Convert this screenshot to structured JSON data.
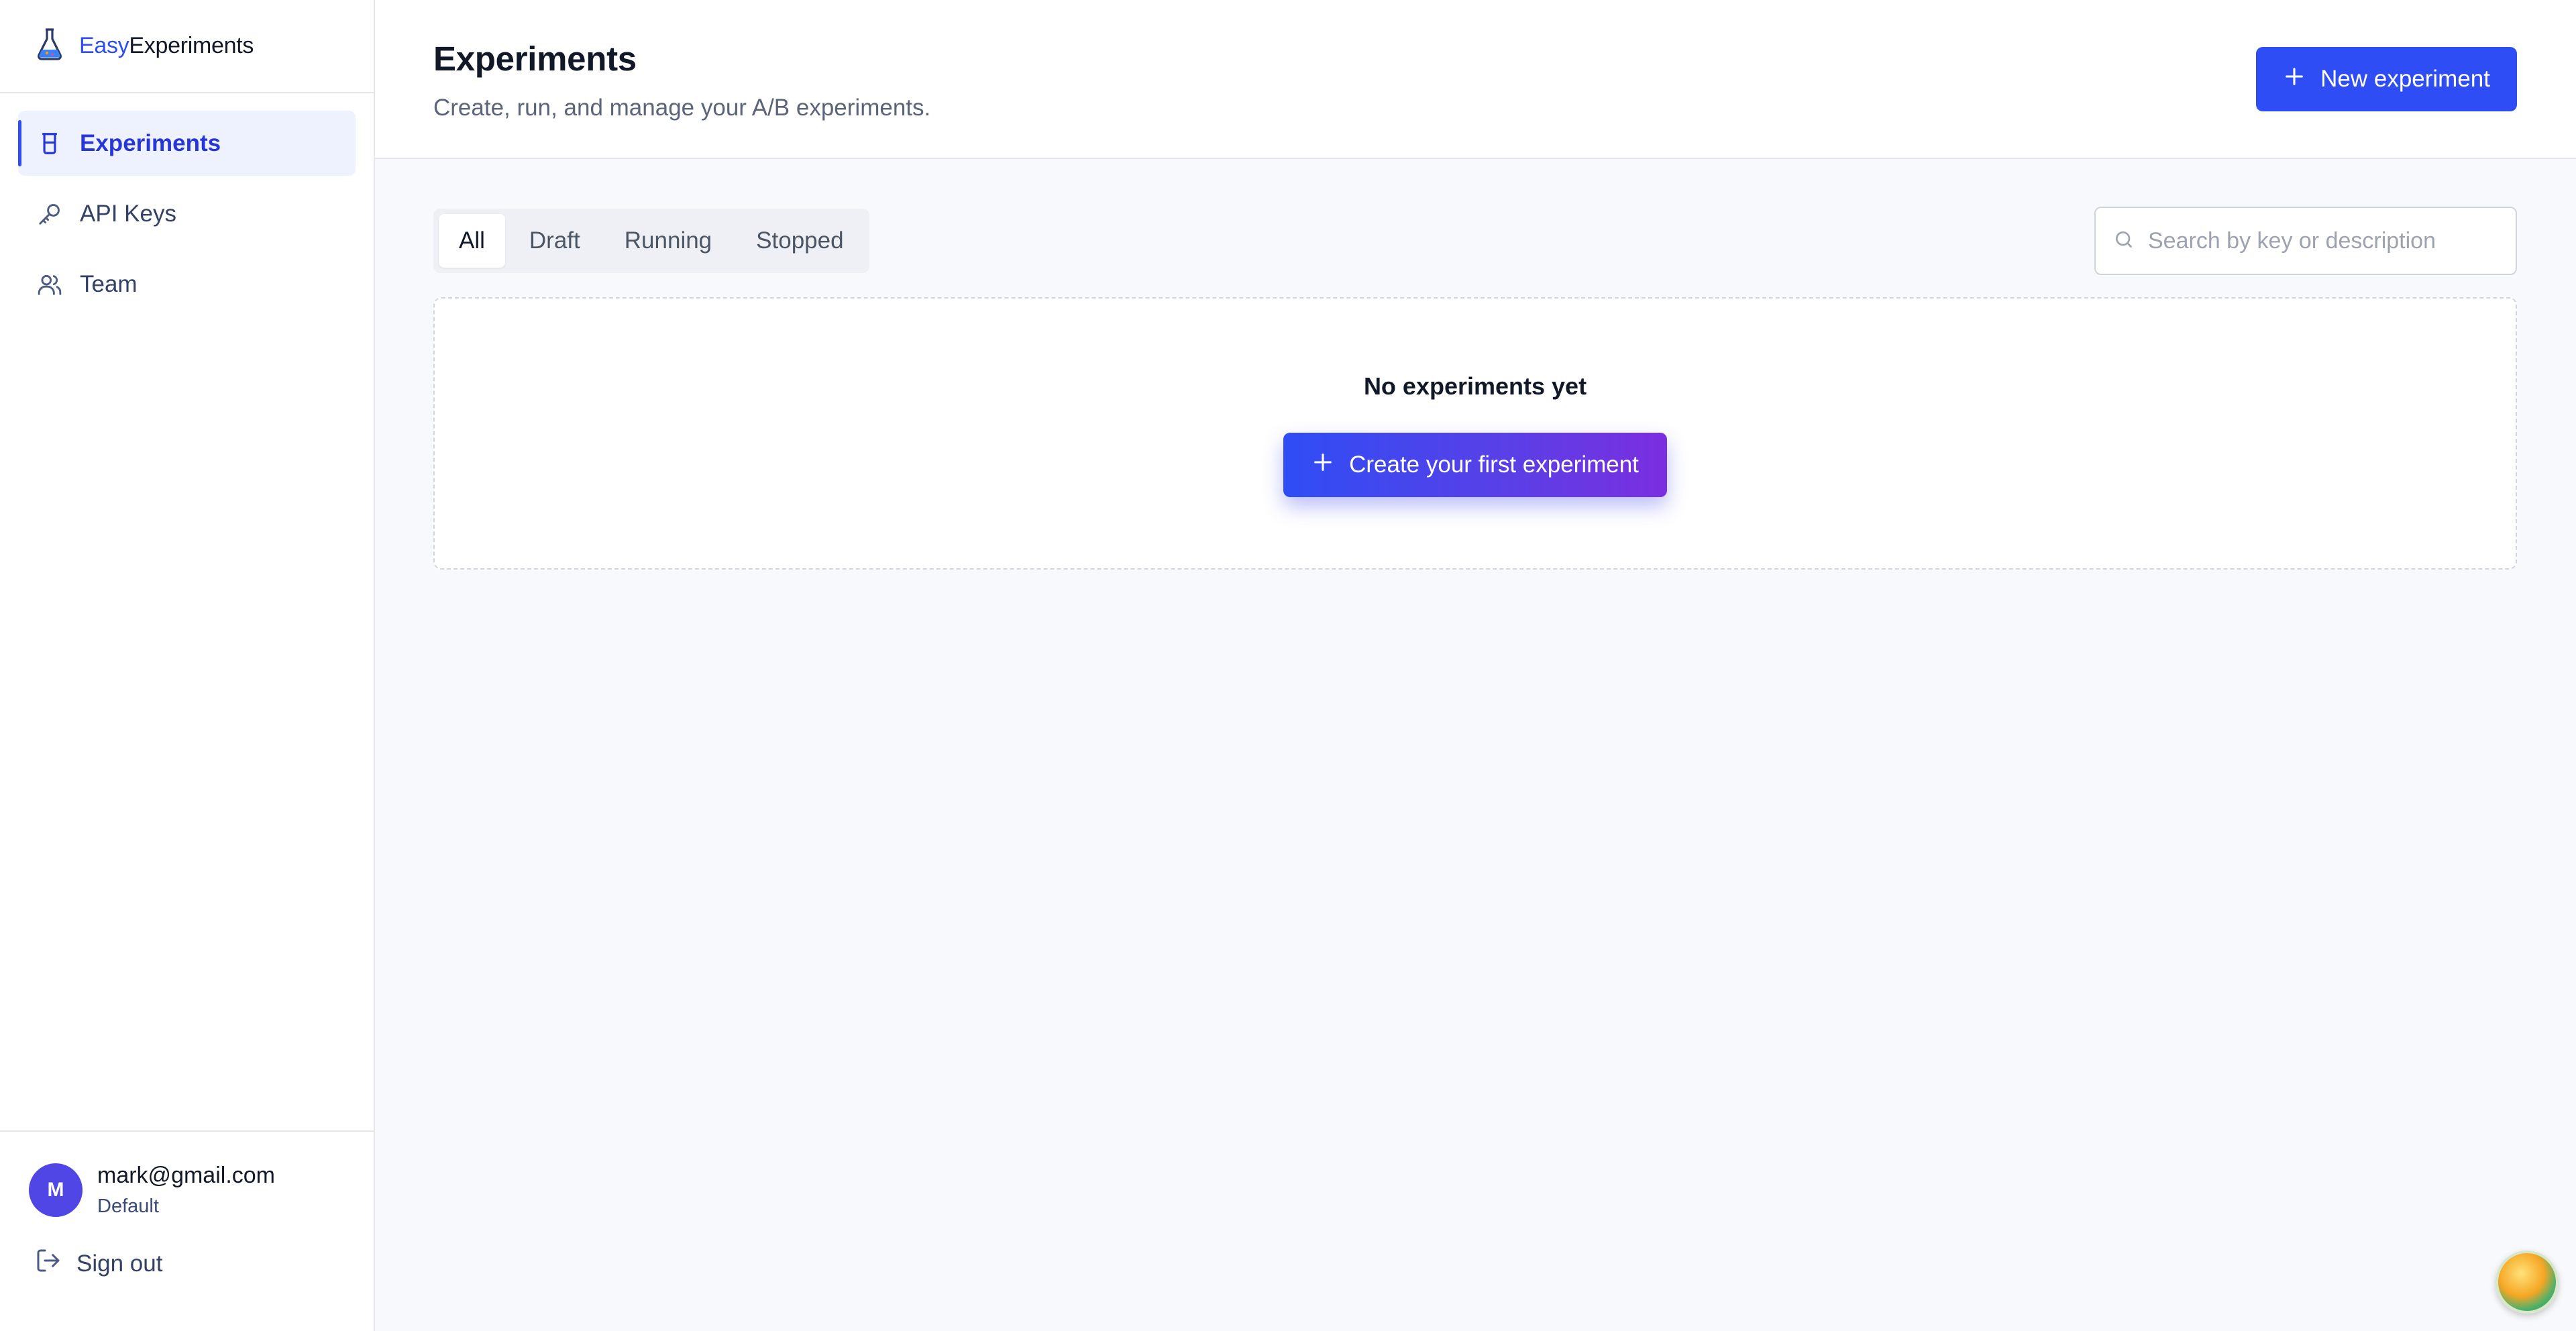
{
  "brand": {
    "easy": "Easy",
    "experiments": "Experiments"
  },
  "sidebar": {
    "items": [
      {
        "label": "Experiments",
        "icon": "beaker-icon",
        "active": true
      },
      {
        "label": "API Keys",
        "icon": "key-icon",
        "active": false
      },
      {
        "label": "Team",
        "icon": "users-icon",
        "active": false
      }
    ],
    "user": {
      "initial": "M",
      "email": "mark@gmail.com",
      "org": "Default"
    },
    "signout_label": "Sign out"
  },
  "header": {
    "title": "Experiments",
    "subtitle": "Create, run, and manage your A/B experiments.",
    "new_button_label": "New experiment"
  },
  "filters": {
    "tabs": [
      "All",
      "Draft",
      "Running",
      "Stopped"
    ],
    "selected": "All"
  },
  "search": {
    "placeholder": "Search by key or description",
    "value": ""
  },
  "empty_state": {
    "title": "No experiments yet",
    "cta_label": "Create your first experiment"
  },
  "colors": {
    "accent": "#2f4df5",
    "active_nav_bg": "#eef1fe",
    "avatar": "#4f46e5",
    "cta_gradient_end": "#7b2ee0"
  }
}
